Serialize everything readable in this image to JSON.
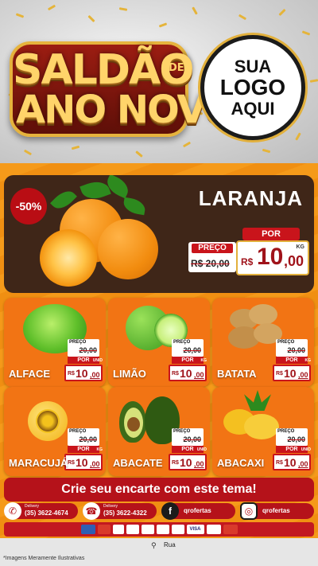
{
  "banner": {
    "title_line1": "SALDÃO",
    "title_de": "DE",
    "title_line2": "ANO NOVO",
    "logo_line1": "SUA",
    "logo_line2": "LOGO",
    "logo_line3": "AQUI"
  },
  "featured": {
    "discount": "-50%",
    "name": "LARANJA",
    "old_label": "PREÇO",
    "old_price": "R$ 20,00",
    "por_label": "POR",
    "currency": "R$",
    "price_int": "10",
    "price_cents": ",00",
    "unit": "KG"
  },
  "products": [
    {
      "name": "ALFACE",
      "old_label": "PREÇO",
      "old_price": "20,00",
      "por": "POR",
      "currency": "R$",
      "price_int": "10",
      "price_cents": ",00",
      "unit": "UNID"
    },
    {
      "name": "LIMÃO",
      "old_label": "PREÇO",
      "old_price": "20,00",
      "por": "POR",
      "currency": "R$",
      "price_int": "10",
      "price_cents": ",00",
      "unit": "KG"
    },
    {
      "name": "BATATA",
      "old_label": "PREÇO",
      "old_price": "20,00",
      "por": "POR",
      "currency": "R$",
      "price_int": "10",
      "price_cents": ",00",
      "unit": "KG"
    },
    {
      "name": "MARACUJÁ",
      "old_label": "PREÇO",
      "old_price": "20,00",
      "por": "POR",
      "currency": "R$",
      "price_int": "10",
      "price_cents": ",00",
      "unit": "KG"
    },
    {
      "name": "ABACATE",
      "old_label": "PREÇO",
      "old_price": "20,00",
      "por": "POR",
      "currency": "R$",
      "price_int": "10",
      "price_cents": ",00",
      "unit": "UNID"
    },
    {
      "name": "ABACAXI",
      "old_label": "PREÇO",
      "old_price": "20,00",
      "por": "POR",
      "currency": "R$",
      "price_int": "10",
      "price_cents": ",00",
      "unit": "UNID"
    }
  ],
  "cta": "Crie seu encarte com este tema!",
  "contacts": {
    "whatsapp_label": "Delivery",
    "whatsapp_phone": "(35) 3622-4674",
    "phone_label": "Delivery",
    "phone_number": "(35) 3622-4322",
    "facebook": "qrofertas",
    "instagram": "qrofertas"
  },
  "payments": [
    "",
    "",
    "",
    "",
    "",
    "",
    "",
    "VISA",
    "",
    ""
  ],
  "footer": {
    "disclaimer": "*Imagens Meramente Ilustrativas",
    "address": "Rua"
  },
  "colors": {
    "brand_red": "#b5121a",
    "orange": "#f59a1a",
    "gold": "#e2b03c",
    "dark_brown": "#3f2618"
  }
}
